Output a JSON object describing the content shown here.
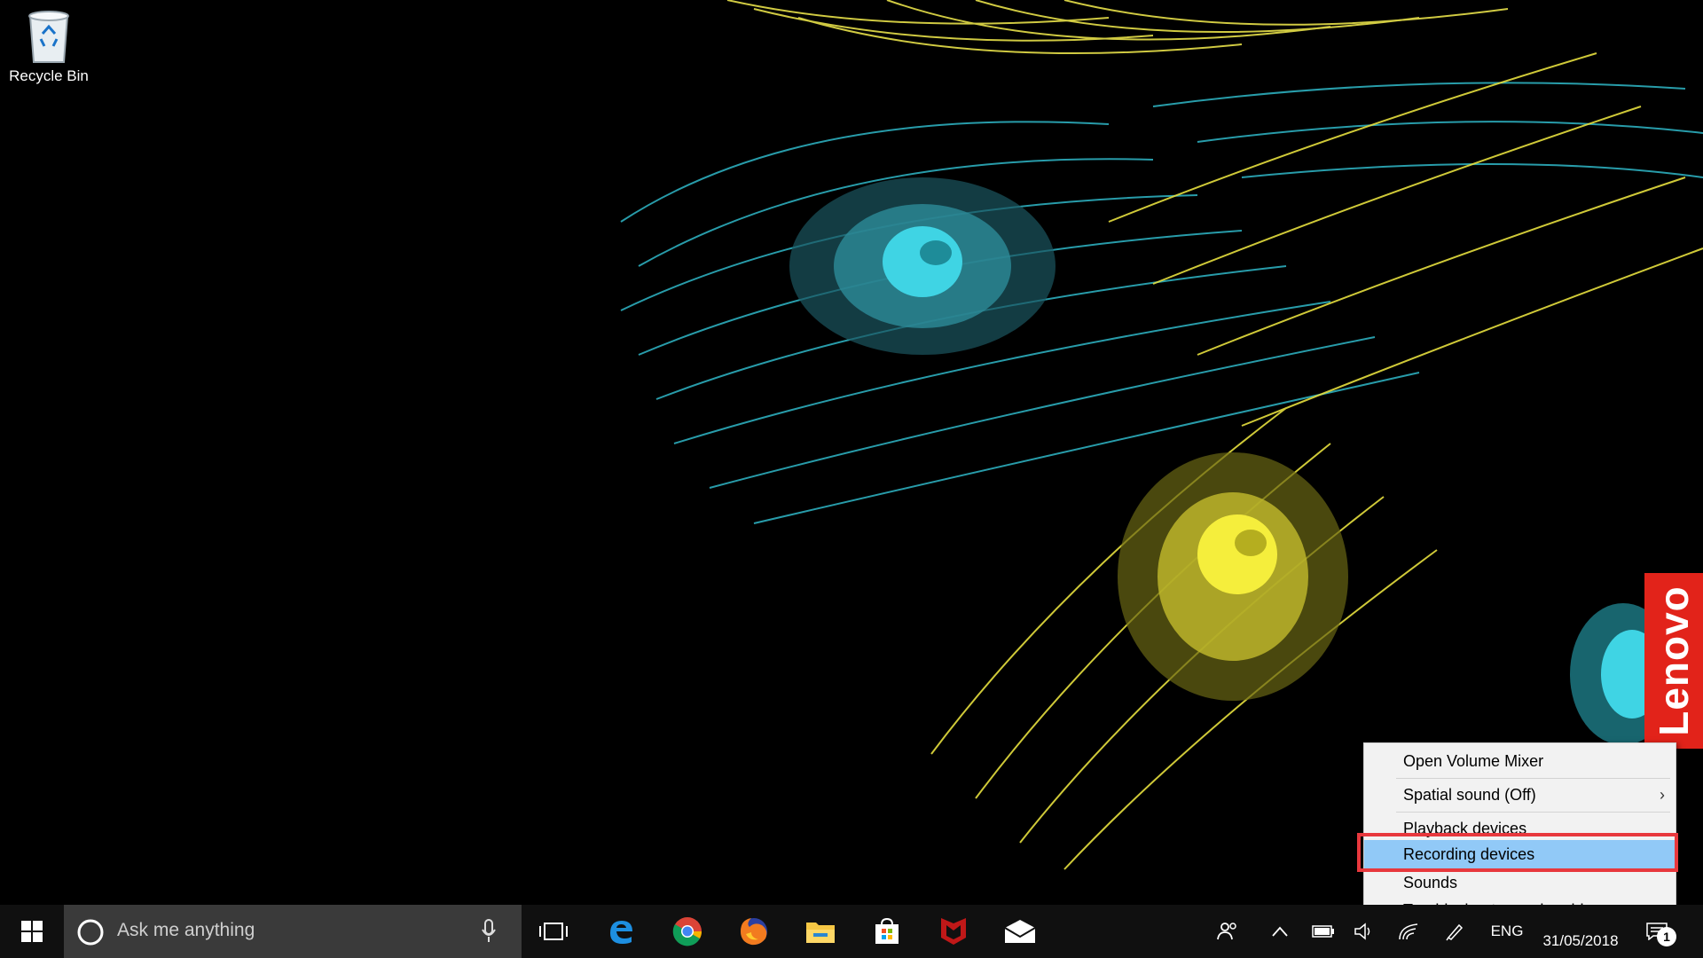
{
  "desktop": {
    "icons": [
      {
        "label": "Recycle Bin",
        "icon": "recycle-bin-icon"
      }
    ],
    "brand_tab": "Lenovo"
  },
  "context_menu": {
    "items": [
      {
        "label": "Open Volume Mixer",
        "has_submenu": false
      },
      {
        "label": "Spatial sound (Off)",
        "has_submenu": true,
        "submenu_glyph": "›"
      },
      {
        "label": "Playback devices",
        "has_submenu": false
      },
      {
        "label": "Recording devices",
        "has_submenu": false,
        "selected": true
      },
      {
        "label": "Sounds",
        "has_submenu": false
      },
      {
        "label": "Troubleshoot sound problems",
        "has_submenu": false
      }
    ],
    "highlight_color": "#e8383d",
    "selection_color": "#91c9f7"
  },
  "taskbar": {
    "search_placeholder": "Ask me anything",
    "pinned_apps": [
      "edge-icon",
      "chrome-icon",
      "firefox-icon",
      "file-explorer-icon",
      "store-icon",
      "mcafee-icon",
      "mail-icon"
    ],
    "tray": {
      "language": "ENG",
      "date": "31/05/2018",
      "notification_count": "1"
    }
  }
}
